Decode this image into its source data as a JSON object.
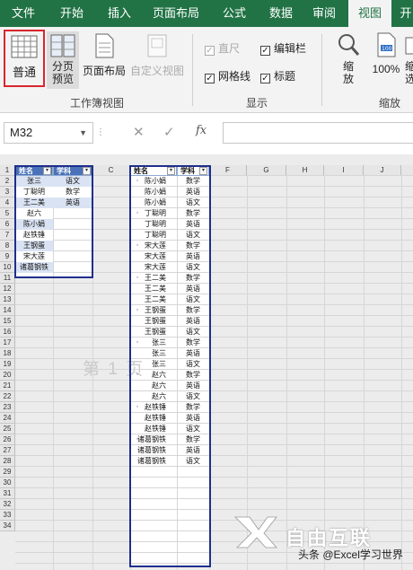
{
  "tabs": [
    "文件",
    "开始",
    "插入",
    "页面布局",
    "公式",
    "数据",
    "审阅",
    "视图",
    "开"
  ],
  "active_tab": "视图",
  "ribbon": {
    "normal_label": "普通",
    "page_break_label_1": "分页",
    "page_break_label_2": "预览",
    "page_layout_label": "页面布局",
    "custom_view_label": "自定义视图",
    "group_workbook_views": "工作簿视图",
    "ruler_label": "直尺",
    "formula_bar_label": "编辑栏",
    "gridlines_label": "网格线",
    "headings_label": "标题",
    "group_show": "显示",
    "zoom_label_1": "缩",
    "zoom_label_2": "放",
    "zoom100_label": "100%",
    "zoom_sel_label_1": "缩",
    "zoom_sel_label_2": "选",
    "group_zoom": "缩放",
    "ruler_checked": true,
    "formula_bar_checked": true,
    "gridlines_checked": true,
    "headings_checked": true
  },
  "formula_bar": {
    "name_box": "M32",
    "cancel_icon": "✕",
    "enter_icon": "✓",
    "fx_label": "fx",
    "value": ""
  },
  "sheet": {
    "columns": [
      "A",
      "B",
      "C",
      "D",
      "E",
      "F",
      "G",
      "H",
      "I",
      "J"
    ],
    "rows": [
      "1",
      "2",
      "3",
      "4",
      "5",
      "6",
      "7",
      "8",
      "9",
      "10",
      "11",
      "12",
      "13",
      "14",
      "15",
      "16",
      "17",
      "18",
      "19",
      "20",
      "21",
      "22",
      "23",
      "24",
      "25",
      "26",
      "27",
      "28",
      "29",
      "30",
      "31",
      "32",
      "33",
      "34"
    ],
    "list_header_name": "姓名",
    "list_header_subject": "学科",
    "col_a_values": [
      "张三",
      "丁聪明",
      "王二美",
      "赵六",
      "陈小娟",
      "赵铁锤",
      "王钢蛋",
      "宋大莲",
      "诸葛钢铁"
    ],
    "col_b_values": [
      "语文",
      "数学",
      "英语"
    ],
    "main_header_name": "姓名",
    "main_header_subject": "学科",
    "main_names": [
      "陈小娟",
      "陈小娟",
      "陈小娟",
      "丁聪明",
      "丁聪明",
      "丁聪明",
      "宋大莲",
      "宋大莲",
      "宋大莲",
      "王二美",
      "王二美",
      "王二美",
      "王钢蛋",
      "王钢蛋",
      "王钢蛋",
      "张三",
      "张三",
      "张三",
      "赵六",
      "赵六",
      "赵六",
      "赵铁锤",
      "赵铁锤",
      "赵铁锤",
      "诸葛钢铁",
      "诸葛钢铁",
      "诸葛钢铁"
    ],
    "main_subjects": [
      "数学",
      "英语",
      "语文",
      "数学",
      "英语",
      "语文",
      "数学",
      "英语",
      "语文",
      "数学",
      "英语",
      "语文",
      "数学",
      "英语",
      "语文",
      "数学",
      "英语",
      "语文",
      "数学",
      "英语",
      "语文",
      "数学",
      "英语",
      "语文",
      "数学",
      "英语",
      "语文"
    ],
    "page_watermark": "第 1 页"
  },
  "overlay": {
    "logo_text": "自由互联",
    "credit": "头条 @Excel学习世界"
  },
  "colors": {
    "excel_green": "#217346",
    "selection_red": "#d9262c",
    "page_border": "#1f2f8c"
  }
}
